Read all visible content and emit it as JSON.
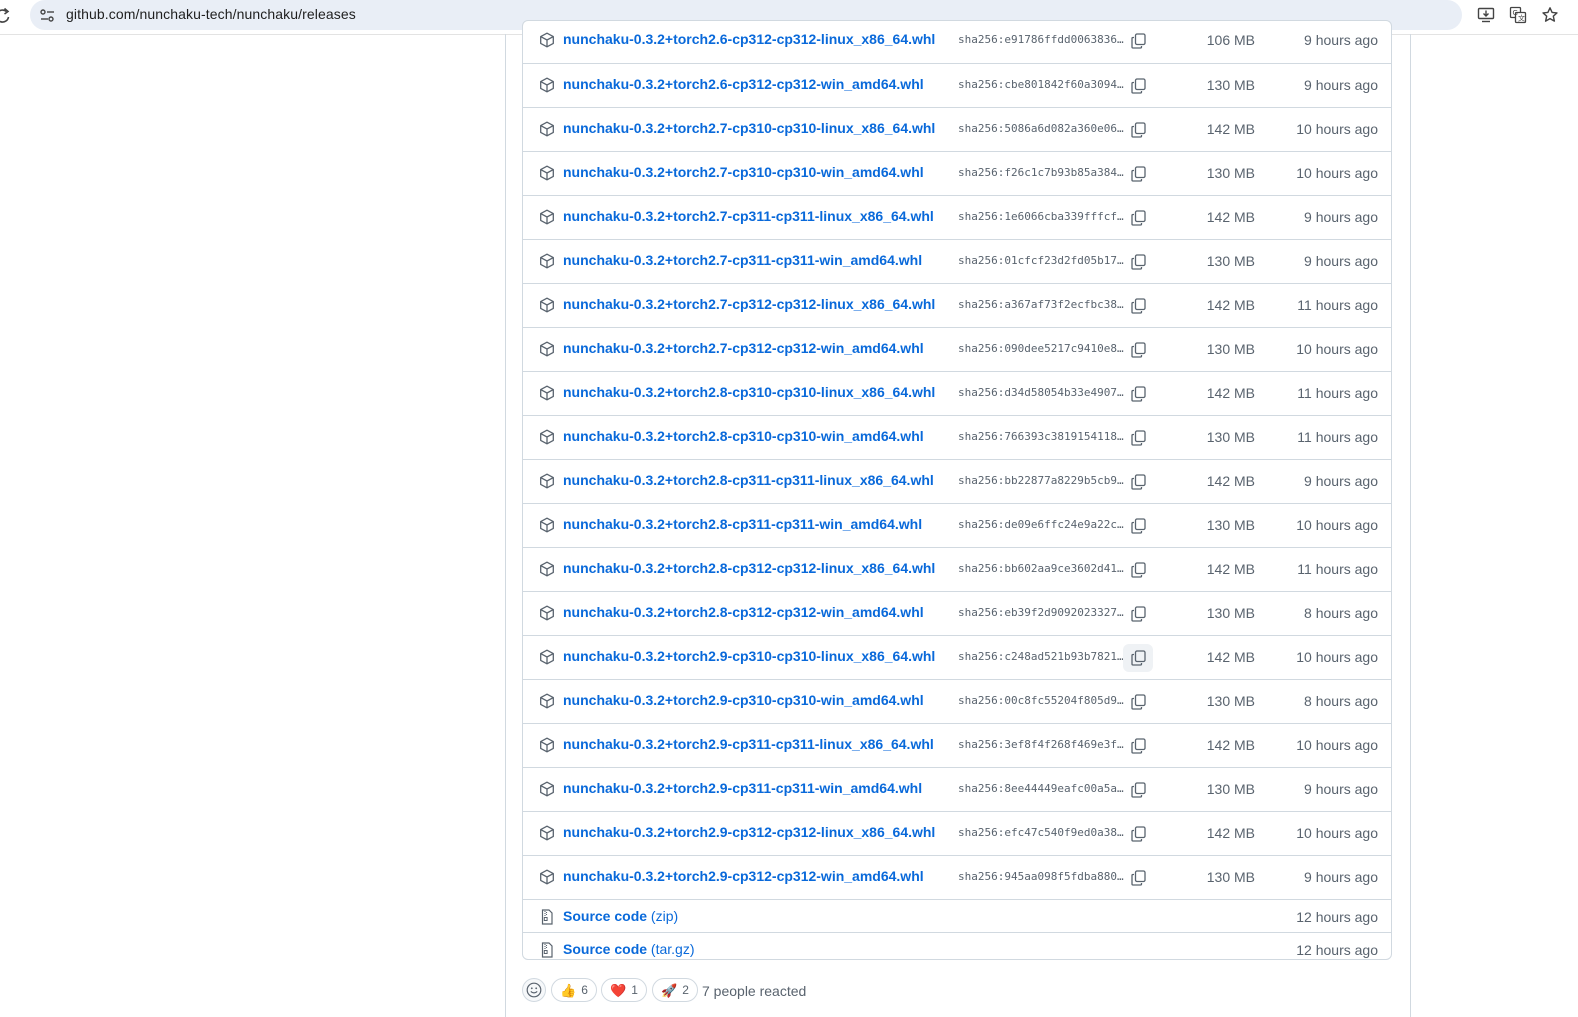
{
  "browser": {
    "url": "github.com/nunchaku-tech/nunchaku/releases"
  },
  "assets": [
    {
      "name": "nunchaku-0.3.2+torch2.6-cp312-cp312-linux_x86_64.whl",
      "sha": "sha256:e91786ffdd0063836…",
      "size": "106 MB",
      "time": "9 hours ago"
    },
    {
      "name": "nunchaku-0.3.2+torch2.6-cp312-cp312-win_amd64.whl",
      "sha": "sha256:cbe801842f60a3094…",
      "size": "130 MB",
      "time": "9 hours ago"
    },
    {
      "name": "nunchaku-0.3.2+torch2.7-cp310-cp310-linux_x86_64.whl",
      "sha": "sha256:5086a6d082a360e06…",
      "size": "142 MB",
      "time": "10 hours ago"
    },
    {
      "name": "nunchaku-0.3.2+torch2.7-cp310-cp310-win_amd64.whl",
      "sha": "sha256:f26c1c7b93b85a384…",
      "size": "130 MB",
      "time": "10 hours ago"
    },
    {
      "name": "nunchaku-0.3.2+torch2.7-cp311-cp311-linux_x86_64.whl",
      "sha": "sha256:1e6066cba339fffcf…",
      "size": "142 MB",
      "time": "9 hours ago"
    },
    {
      "name": "nunchaku-0.3.2+torch2.7-cp311-cp311-win_amd64.whl",
      "sha": "sha256:01cfcf23d2fd05b17…",
      "size": "130 MB",
      "time": "9 hours ago"
    },
    {
      "name": "nunchaku-0.3.2+torch2.7-cp312-cp312-linux_x86_64.whl",
      "sha": "sha256:a367af73f2ecfbc38…",
      "size": "142 MB",
      "time": "11 hours ago"
    },
    {
      "name": "nunchaku-0.3.2+torch2.7-cp312-cp312-win_amd64.whl",
      "sha": "sha256:090dee5217c9410e8…",
      "size": "130 MB",
      "time": "10 hours ago"
    },
    {
      "name": "nunchaku-0.3.2+torch2.8-cp310-cp310-linux_x86_64.whl",
      "sha": "sha256:d34d58054b33e4907…",
      "size": "142 MB",
      "time": "11 hours ago"
    },
    {
      "name": "nunchaku-0.3.2+torch2.8-cp310-cp310-win_amd64.whl",
      "sha": "sha256:766393c3819154118…",
      "size": "130 MB",
      "time": "11 hours ago"
    },
    {
      "name": "nunchaku-0.3.2+torch2.8-cp311-cp311-linux_x86_64.whl",
      "sha": "sha256:bb22877a8229b5cb9…",
      "size": "142 MB",
      "time": "9 hours ago"
    },
    {
      "name": "nunchaku-0.3.2+torch2.8-cp311-cp311-win_amd64.whl",
      "sha": "sha256:de09e6ffc24e9a22c…",
      "size": "130 MB",
      "time": "10 hours ago"
    },
    {
      "name": "nunchaku-0.3.2+torch2.8-cp312-cp312-linux_x86_64.whl",
      "sha": "sha256:bb602aa9ce3602d41…",
      "size": "142 MB",
      "time": "11 hours ago"
    },
    {
      "name": "nunchaku-0.3.2+torch2.8-cp312-cp312-win_amd64.whl",
      "sha": "sha256:eb39f2d9092023327…",
      "size": "130 MB",
      "time": "8 hours ago"
    },
    {
      "name": "nunchaku-0.3.2+torch2.9-cp310-cp310-linux_x86_64.whl",
      "sha": "sha256:c248ad521b93b7821…",
      "size": "142 MB",
      "time": "10 hours ago"
    },
    {
      "name": "nunchaku-0.3.2+torch2.9-cp310-cp310-win_amd64.whl",
      "sha": "sha256:00c8fc55204f805d9…",
      "size": "130 MB",
      "time": "8 hours ago"
    },
    {
      "name": "nunchaku-0.3.2+torch2.9-cp311-cp311-linux_x86_64.whl",
      "sha": "sha256:3ef8f4f268f469e3f…",
      "size": "142 MB",
      "time": "10 hours ago"
    },
    {
      "name": "nunchaku-0.3.2+torch2.9-cp311-cp311-win_amd64.whl",
      "sha": "sha256:8ee44449eafc00a5a…",
      "size": "130 MB",
      "time": "9 hours ago"
    },
    {
      "name": "nunchaku-0.3.2+torch2.9-cp312-cp312-linux_x86_64.whl",
      "sha": "sha256:efc47c540f9ed0a38…",
      "size": "142 MB",
      "time": "10 hours ago"
    },
    {
      "name": "nunchaku-0.3.2+torch2.9-cp312-cp312-win_amd64.whl",
      "sha": "sha256:945aa098f5fdba880…",
      "size": "130 MB",
      "time": "9 hours ago"
    }
  ],
  "sources": [
    {
      "label": "Source code",
      "ext": "(zip)",
      "time": "12 hours ago"
    },
    {
      "label": "Source code",
      "ext": "(tar.gz)",
      "time": "12 hours ago"
    }
  ],
  "reactions": {
    "items": [
      {
        "emoji": "👍",
        "count": "6"
      },
      {
        "emoji": "❤️",
        "count": "1"
      },
      {
        "emoji": "🚀",
        "count": "2"
      }
    ],
    "summary": "7 people reacted"
  },
  "colors": {
    "link": "#0969da",
    "muted": "#59636e",
    "border": "#d1d9e0"
  }
}
